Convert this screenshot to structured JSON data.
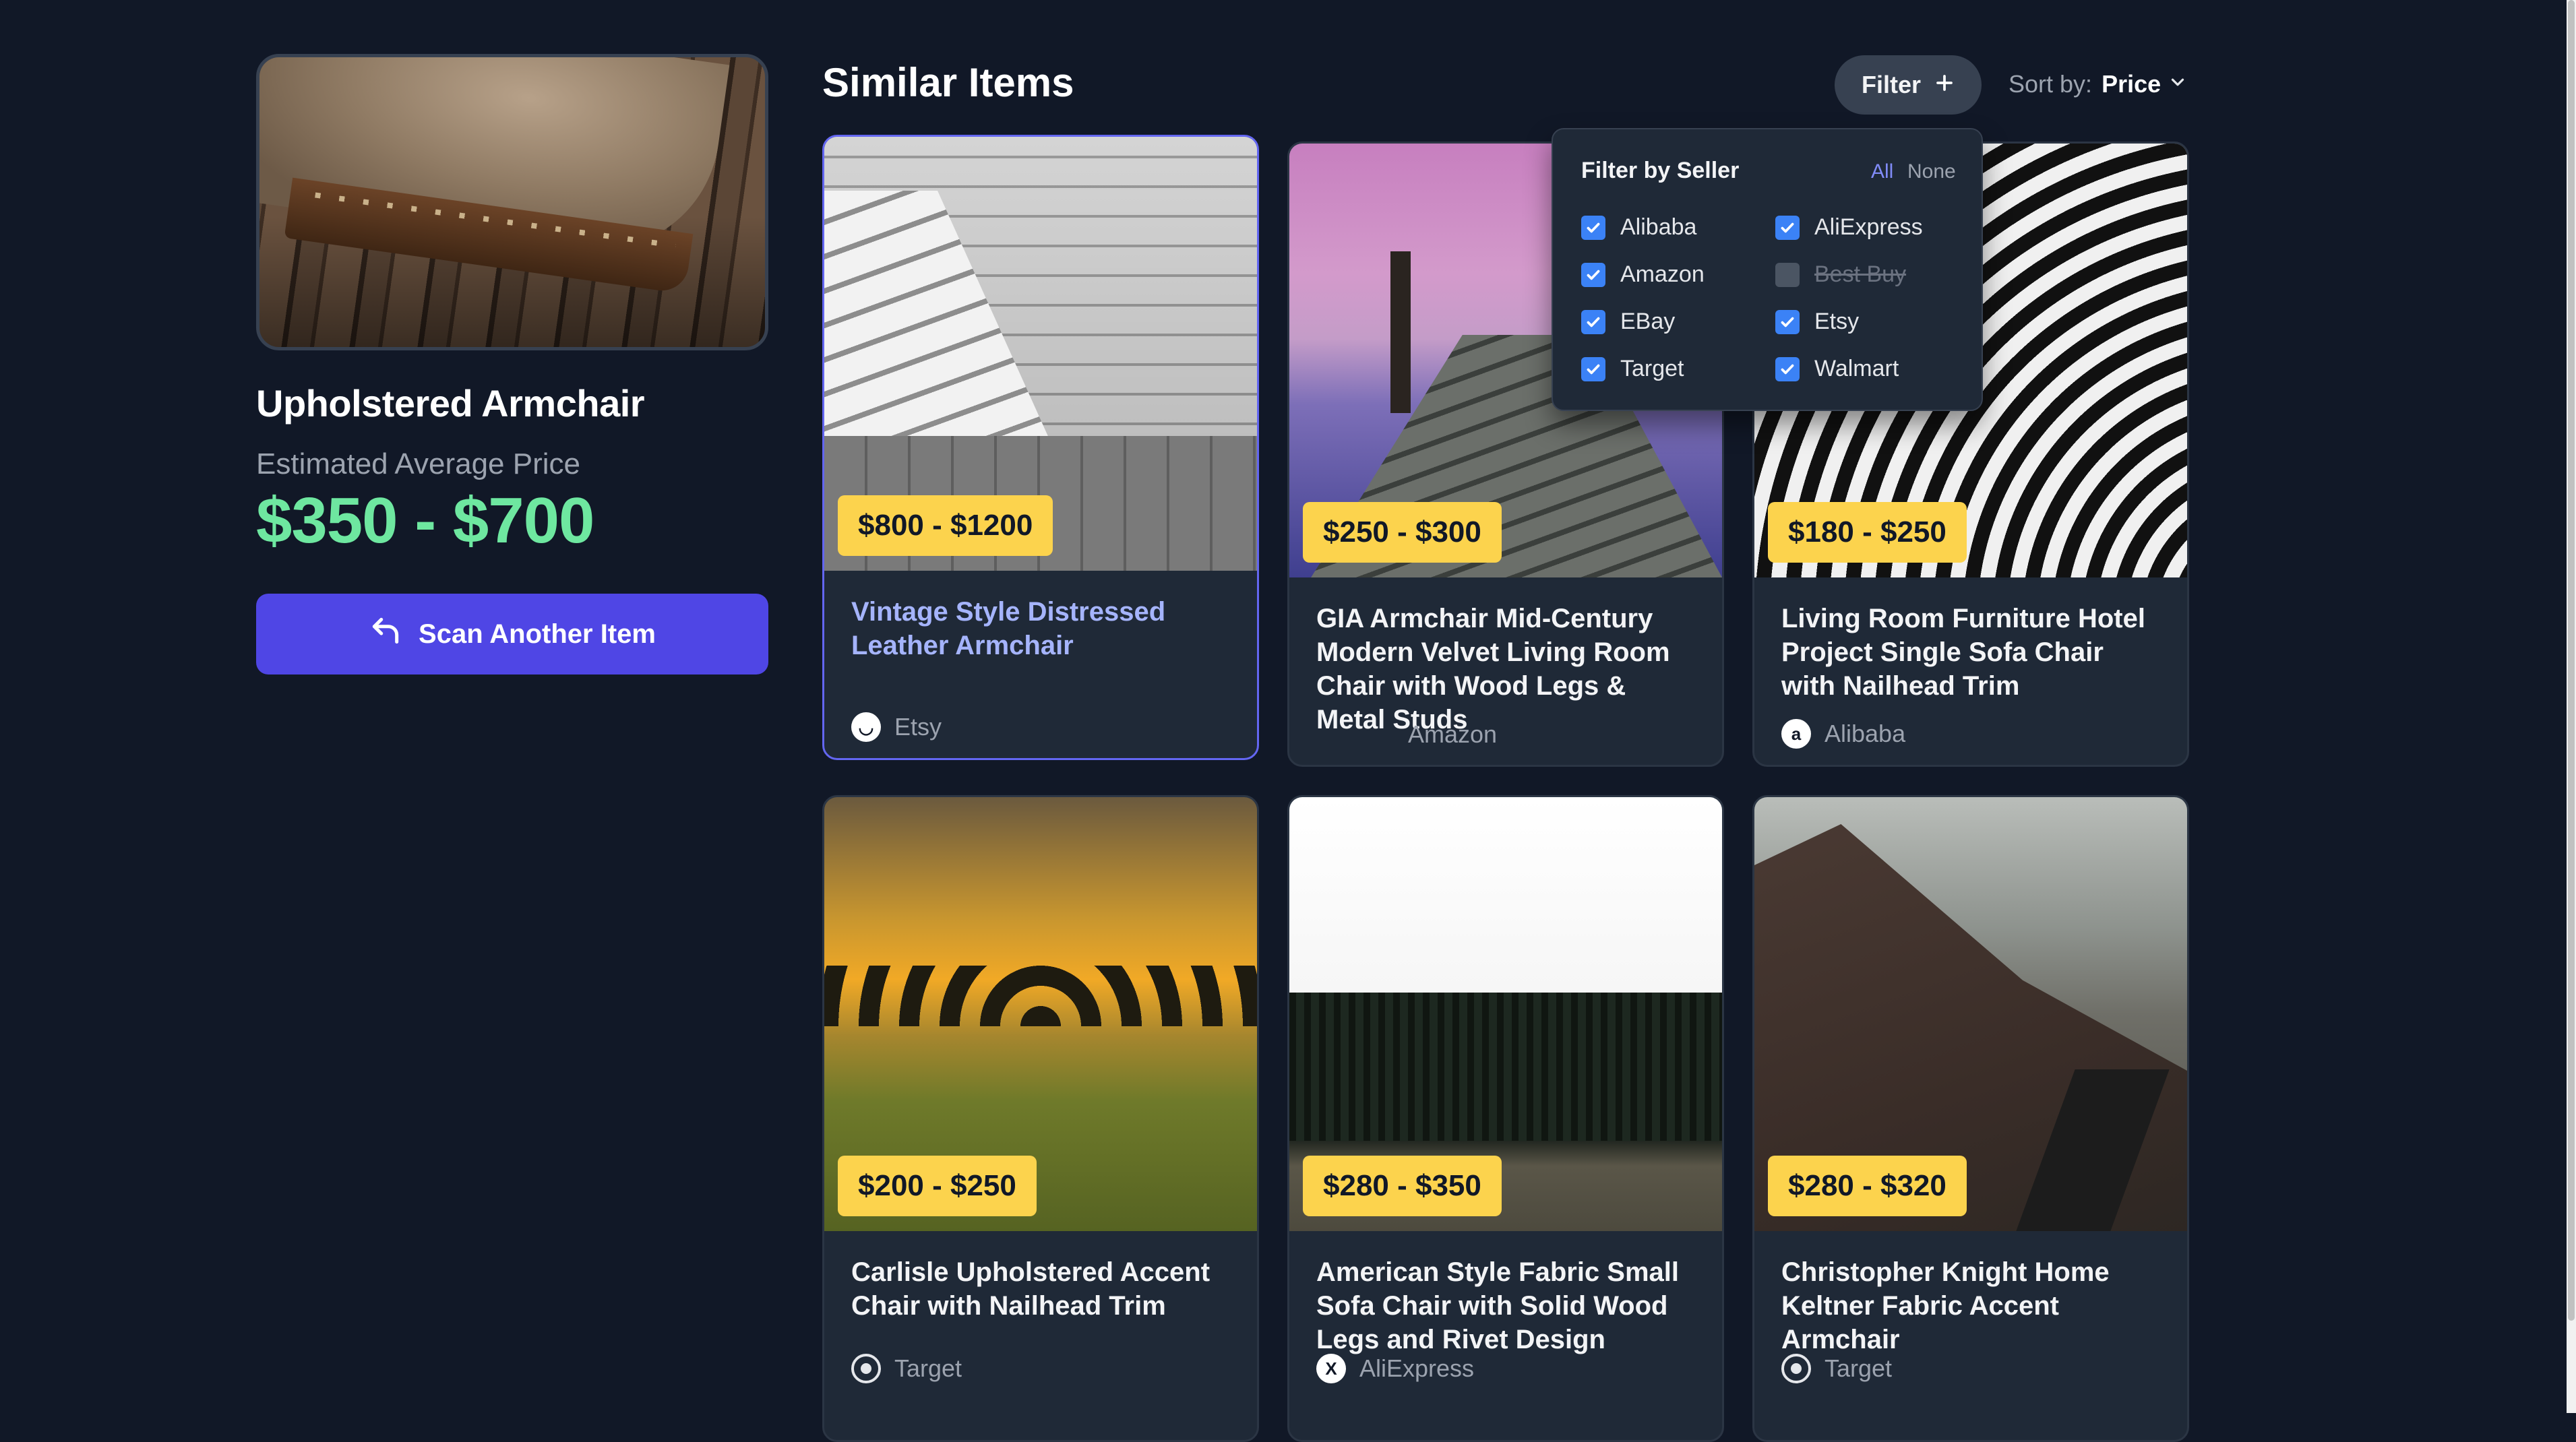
{
  "product": {
    "title": "Upholstered Armchair",
    "estimate_label": "Estimated Average Price",
    "estimate_price": "$350 - $700",
    "scan_button_label": "Scan Another Item"
  },
  "header": {
    "section_title": "Similar Items",
    "filter_label": "Filter",
    "sort_label": "Sort by:",
    "sort_value": "Price"
  },
  "filter_popover": {
    "title": "Filter by Seller",
    "all_label": "All",
    "none_label": "None",
    "options": [
      {
        "label": "Alibaba",
        "checked": true
      },
      {
        "label": "AliExpress",
        "checked": true
      },
      {
        "label": "Amazon",
        "checked": true
      },
      {
        "label": "Best Buy",
        "checked": false
      },
      {
        "label": "EBay",
        "checked": true
      },
      {
        "label": "Etsy",
        "checked": true
      },
      {
        "label": "Target",
        "checked": true
      },
      {
        "label": "Walmart",
        "checked": true
      }
    ]
  },
  "items": [
    {
      "price": "$800 - $1200",
      "name": "Vintage Style Distressed Leather Armchair",
      "seller": "Etsy",
      "seller_icon": "etsy-icon",
      "selected": true
    },
    {
      "price": "$250 - $300",
      "name": "GIA Armchair Mid-Century Modern Velvet Living Room Chair with Wood Legs & Metal Studs",
      "seller": "Amazon",
      "seller_icon": "amazon-icon",
      "selected": false
    },
    {
      "price": "$180 - $250",
      "name": "Living Room Furniture Hotel Project Single Sofa Chair with Nailhead Trim",
      "seller": "Alibaba",
      "seller_icon": "alibaba-icon",
      "selected": false
    },
    {
      "price": "$200 - $250",
      "name": "Carlisle Upholstered Accent Chair with Nailhead Trim",
      "seller": "Target",
      "seller_icon": "target-icon",
      "selected": false
    },
    {
      "price": "$280 - $350",
      "name": "American Style Fabric Small Sofa Chair with Solid Wood Legs and Rivet Design",
      "seller": "AliExpress",
      "seller_icon": "aliexpress-icon",
      "selected": false
    },
    {
      "price": "$280 - $320",
      "name": "Christopher Knight Home Keltner Fabric Accent Armchair",
      "seller": "Target",
      "seller_icon": "target-icon",
      "selected": false
    }
  ],
  "colors": {
    "background": "#111827",
    "card": "#1f2937",
    "accent": "#4f46e5",
    "price_green": "#6ee7a0",
    "badge_yellow": "#fcd34d",
    "checkbox_blue": "#3b82f6"
  }
}
